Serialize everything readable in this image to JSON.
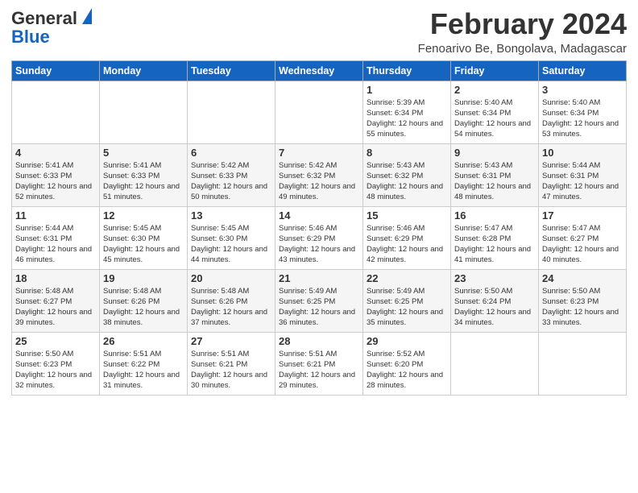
{
  "logo": {
    "line1": "General",
    "line2": "Blue"
  },
  "header": {
    "title": "February 2024",
    "subtitle": "Fenoarivo Be, Bongolava, Madagascar"
  },
  "days_of_week": [
    "Sunday",
    "Monday",
    "Tuesday",
    "Wednesday",
    "Thursday",
    "Friday",
    "Saturday"
  ],
  "weeks": [
    [
      {
        "day": "",
        "info": ""
      },
      {
        "day": "",
        "info": ""
      },
      {
        "day": "",
        "info": ""
      },
      {
        "day": "",
        "info": ""
      },
      {
        "day": "1",
        "info": "Sunrise: 5:39 AM\nSunset: 6:34 PM\nDaylight: 12 hours and 55 minutes."
      },
      {
        "day": "2",
        "info": "Sunrise: 5:40 AM\nSunset: 6:34 PM\nDaylight: 12 hours and 54 minutes."
      },
      {
        "day": "3",
        "info": "Sunrise: 5:40 AM\nSunset: 6:34 PM\nDaylight: 12 hours and 53 minutes."
      }
    ],
    [
      {
        "day": "4",
        "info": "Sunrise: 5:41 AM\nSunset: 6:33 PM\nDaylight: 12 hours and 52 minutes."
      },
      {
        "day": "5",
        "info": "Sunrise: 5:41 AM\nSunset: 6:33 PM\nDaylight: 12 hours and 51 minutes."
      },
      {
        "day": "6",
        "info": "Sunrise: 5:42 AM\nSunset: 6:33 PM\nDaylight: 12 hours and 50 minutes."
      },
      {
        "day": "7",
        "info": "Sunrise: 5:42 AM\nSunset: 6:32 PM\nDaylight: 12 hours and 49 minutes."
      },
      {
        "day": "8",
        "info": "Sunrise: 5:43 AM\nSunset: 6:32 PM\nDaylight: 12 hours and 48 minutes."
      },
      {
        "day": "9",
        "info": "Sunrise: 5:43 AM\nSunset: 6:31 PM\nDaylight: 12 hours and 48 minutes."
      },
      {
        "day": "10",
        "info": "Sunrise: 5:44 AM\nSunset: 6:31 PM\nDaylight: 12 hours and 47 minutes."
      }
    ],
    [
      {
        "day": "11",
        "info": "Sunrise: 5:44 AM\nSunset: 6:31 PM\nDaylight: 12 hours and 46 minutes."
      },
      {
        "day": "12",
        "info": "Sunrise: 5:45 AM\nSunset: 6:30 PM\nDaylight: 12 hours and 45 minutes."
      },
      {
        "day": "13",
        "info": "Sunrise: 5:45 AM\nSunset: 6:30 PM\nDaylight: 12 hours and 44 minutes."
      },
      {
        "day": "14",
        "info": "Sunrise: 5:46 AM\nSunset: 6:29 PM\nDaylight: 12 hours and 43 minutes."
      },
      {
        "day": "15",
        "info": "Sunrise: 5:46 AM\nSunset: 6:29 PM\nDaylight: 12 hours and 42 minutes."
      },
      {
        "day": "16",
        "info": "Sunrise: 5:47 AM\nSunset: 6:28 PM\nDaylight: 12 hours and 41 minutes."
      },
      {
        "day": "17",
        "info": "Sunrise: 5:47 AM\nSunset: 6:27 PM\nDaylight: 12 hours and 40 minutes."
      }
    ],
    [
      {
        "day": "18",
        "info": "Sunrise: 5:48 AM\nSunset: 6:27 PM\nDaylight: 12 hours and 39 minutes."
      },
      {
        "day": "19",
        "info": "Sunrise: 5:48 AM\nSunset: 6:26 PM\nDaylight: 12 hours and 38 minutes."
      },
      {
        "day": "20",
        "info": "Sunrise: 5:48 AM\nSunset: 6:26 PM\nDaylight: 12 hours and 37 minutes."
      },
      {
        "day": "21",
        "info": "Sunrise: 5:49 AM\nSunset: 6:25 PM\nDaylight: 12 hours and 36 minutes."
      },
      {
        "day": "22",
        "info": "Sunrise: 5:49 AM\nSunset: 6:25 PM\nDaylight: 12 hours and 35 minutes."
      },
      {
        "day": "23",
        "info": "Sunrise: 5:50 AM\nSunset: 6:24 PM\nDaylight: 12 hours and 34 minutes."
      },
      {
        "day": "24",
        "info": "Sunrise: 5:50 AM\nSunset: 6:23 PM\nDaylight: 12 hours and 33 minutes."
      }
    ],
    [
      {
        "day": "25",
        "info": "Sunrise: 5:50 AM\nSunset: 6:23 PM\nDaylight: 12 hours and 32 minutes."
      },
      {
        "day": "26",
        "info": "Sunrise: 5:51 AM\nSunset: 6:22 PM\nDaylight: 12 hours and 31 minutes."
      },
      {
        "day": "27",
        "info": "Sunrise: 5:51 AM\nSunset: 6:21 PM\nDaylight: 12 hours and 30 minutes."
      },
      {
        "day": "28",
        "info": "Sunrise: 5:51 AM\nSunset: 6:21 PM\nDaylight: 12 hours and 29 minutes."
      },
      {
        "day": "29",
        "info": "Sunrise: 5:52 AM\nSunset: 6:20 PM\nDaylight: 12 hours and 28 minutes."
      },
      {
        "day": "",
        "info": ""
      },
      {
        "day": "",
        "info": ""
      }
    ]
  ]
}
